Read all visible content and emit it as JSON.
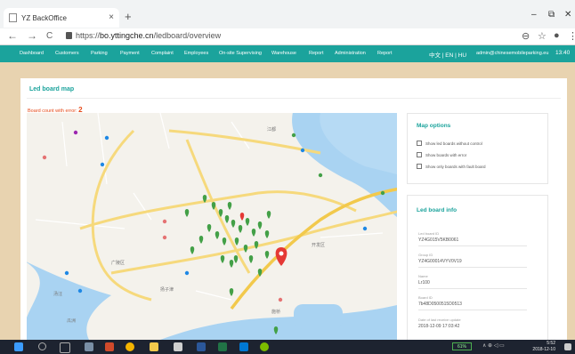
{
  "browser": {
    "tab_title": "YZ BackOffice",
    "tab_close": "×",
    "new_tab": "+",
    "url_prefix": "https://",
    "url_domain": "bo.yttingche.cn",
    "url_path": "/ledboard/overview",
    "window_controls": [
      "–",
      "⧉",
      "✕"
    ],
    "nav": {
      "back": "←",
      "forward": "→",
      "reload": "C"
    },
    "address_icons": [
      "⊖",
      "☆",
      "●",
      "⋮"
    ]
  },
  "app_nav": {
    "items": [
      "Dashboard",
      "Customers",
      "Parking",
      "Payment",
      "Complaint",
      "Employees",
      "On-site Supervising",
      "Warehouse",
      "Report",
      "Administration",
      "Report"
    ],
    "languages": "中文 | EN | HU",
    "user_email": "admin@chinesemobileparking.eu",
    "time": "13:40"
  },
  "panel": {
    "title": "Led board map",
    "count_label": "Board count with error:",
    "count_value": "2"
  },
  "map_options": {
    "title": "Map options",
    "options": [
      {
        "label": "Show led boards without control",
        "checked": false
      },
      {
        "label": "Show boards with error",
        "checked": false
      },
      {
        "label": "Show only boards with fault board",
        "checked": false
      }
    ]
  },
  "led_info": {
    "title": "Led board info",
    "fields": [
      {
        "label": "Led board ID",
        "value": "YZ4G015V5KB0061"
      },
      {
        "label": "Group ID",
        "value": "YZ4G00014VYV0V19"
      },
      {
        "label": "Name",
        "value": "Lr100"
      },
      {
        "label": "Board ID",
        "value": "7b48D0500515D0513"
      },
      {
        "label": "Date of last receive update",
        "value": "2018-12-09 17:03:42"
      }
    ]
  },
  "map": {
    "labels": [
      "广陵区",
      "江都",
      "汤汪",
      "开发区",
      "扬子津",
      "瓜洲",
      "施桥"
    ],
    "marker_colors": {
      "ok": "#43a047",
      "error": "#e53935",
      "poi": "#1e88e5"
    }
  },
  "taskbar": {
    "battery": "61%",
    "tray": "∧ ⊕ ◁ ▭",
    "time": "5:52",
    "date": "2018-12-10"
  }
}
